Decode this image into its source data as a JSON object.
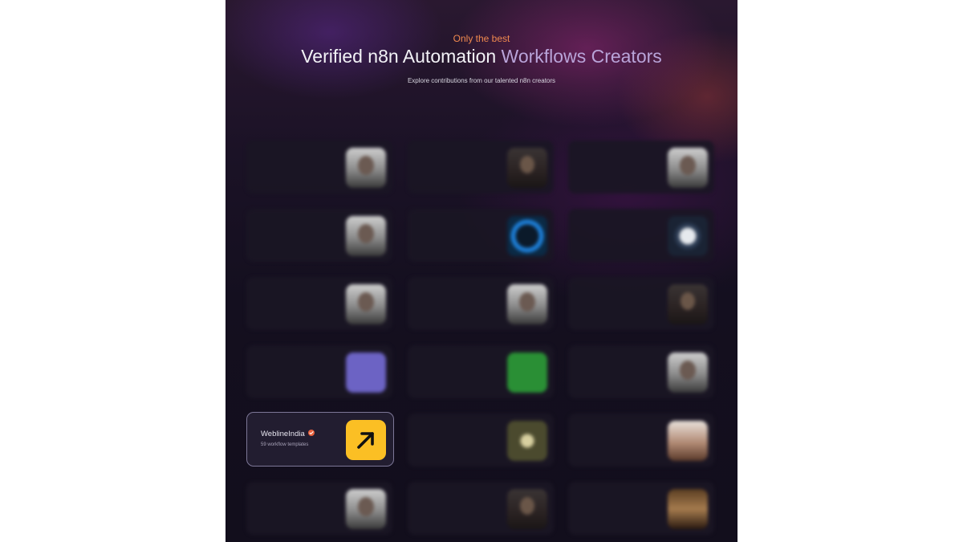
{
  "header": {
    "eyebrow": "Only the best",
    "title_main": "Verified n8n Automation",
    "title_accent": "Workflows Creators",
    "subtitle": "Explore contributions from our talented n8n creators"
  },
  "featured_creator": {
    "name": "WeblineIndia",
    "templates": "59 workflow templates",
    "badge_color": "#e8603c",
    "avatar_icon": "arrow-up-right-icon",
    "avatar_bg": "#fbbf24"
  }
}
